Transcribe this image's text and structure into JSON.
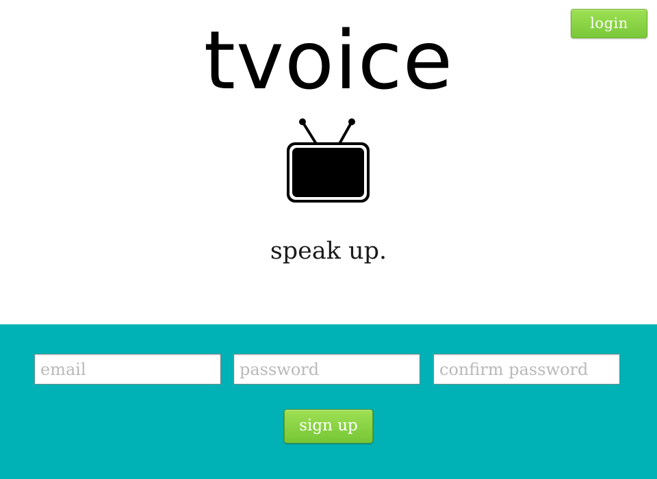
{
  "header": {
    "login_label": "login"
  },
  "brand": {
    "title": "tvoice",
    "logo_icon": "tv-icon",
    "tagline": "speak up."
  },
  "signup_form": {
    "email_placeholder": "email",
    "password_placeholder": "password",
    "confirm_password_placeholder": "confirm password",
    "submit_label": "sign up"
  },
  "colors": {
    "form_background": "#00b2b6",
    "button_green": "#8bd445",
    "page_background": "#ffffff"
  }
}
